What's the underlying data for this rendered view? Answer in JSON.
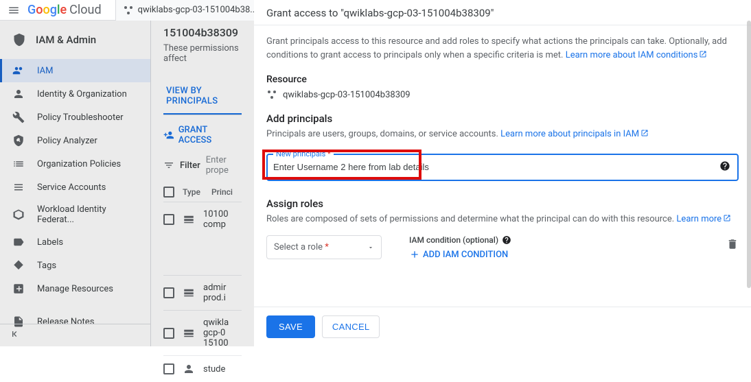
{
  "header": {
    "cloud_label": "Cloud",
    "project_name": "qwiklabs-gcp-03-151004b38..."
  },
  "sidebar": {
    "title": "IAM & Admin",
    "items": [
      {
        "label": "IAM"
      },
      {
        "label": "Identity & Organization"
      },
      {
        "label": "Policy Troubleshooter"
      },
      {
        "label": "Policy Analyzer"
      },
      {
        "label": "Organization Policies"
      },
      {
        "label": "Service Accounts"
      },
      {
        "label": "Workload Identity Federat..."
      },
      {
        "label": "Labels"
      },
      {
        "label": "Tags"
      },
      {
        "label": "Manage Resources"
      },
      {
        "label": "Release Notes"
      }
    ]
  },
  "mid": {
    "heading": "151004b38309",
    "desc": "These permissions affect",
    "tab_view": "VIEW BY PRINCIPALS",
    "grant_access": "GRANT ACCESS",
    "filter": "Filter",
    "filter_hint": "Enter prope",
    "col_type": "Type",
    "col_principal": "Princi",
    "rows": [
      {
        "principal": "10100 comp"
      },
      {
        "principal": "admir prod.i"
      },
      {
        "principal": "qwikla gcp-0 15100"
      },
      {
        "principal": "stude"
      }
    ]
  },
  "panel": {
    "title": "Grant access to \"qwiklabs-gcp-03-151004b38309\"",
    "intro": "Grant principals access to this resource and add roles to specify what actions the principals can take. Optionally, add conditions to grant access to principals only when a specific criteria is met.",
    "intro_link": "Learn more about IAM conditions",
    "resource_h": "Resource",
    "resource_val": "qwiklabs-gcp-03-151004b38309",
    "add_principals_h": "Add principals",
    "add_principals_p": "Principals are users, groups, domains, or service accounts.",
    "add_principals_link": "Learn more about principals in IAM",
    "new_principals_label": "New principals",
    "new_principals_value": "Enter Username 2 here from lab details",
    "assign_h": "Assign roles",
    "assign_p": "Roles are composed of sets of permissions and determine what the principal can do with this resource.",
    "assign_link": "Learn more",
    "select_role": "Select a role",
    "iam_cond": "IAM condition (optional)",
    "add_iam_cond": "ADD IAM CONDITION",
    "save": "SAVE",
    "cancel": "CANCEL"
  }
}
